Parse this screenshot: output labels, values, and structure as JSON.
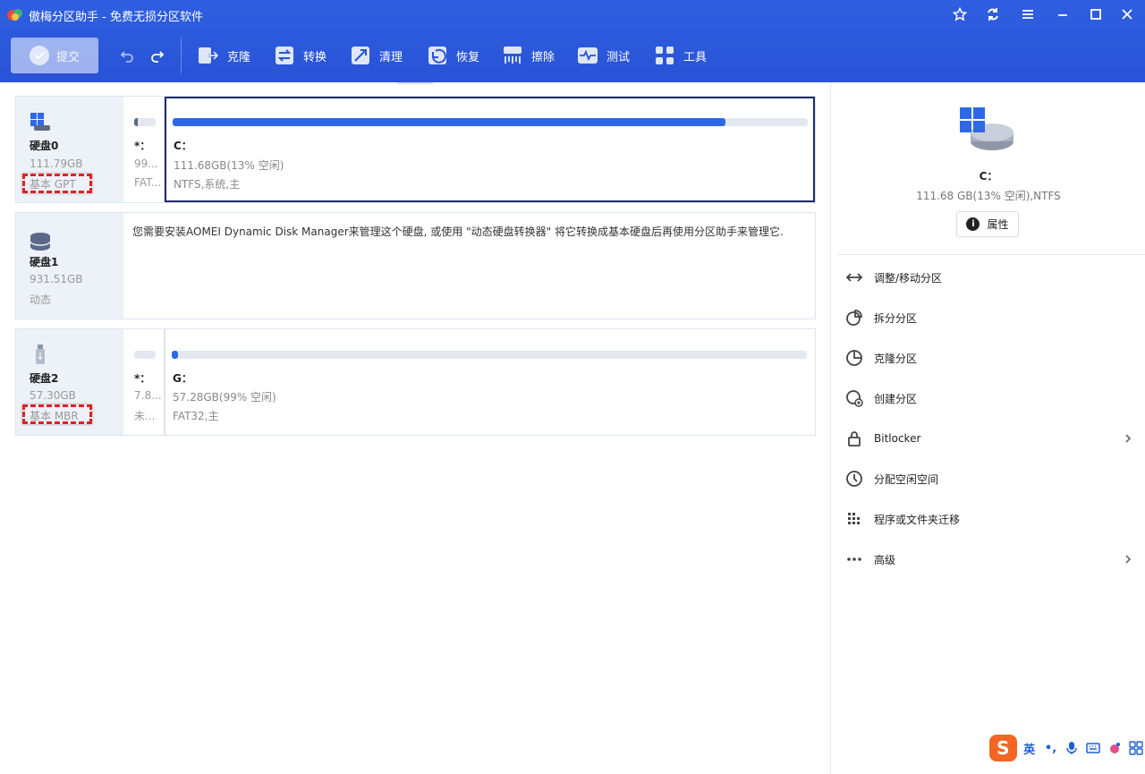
{
  "app": {
    "title": "傲梅分区助手 - 免费无损分区软件"
  },
  "window_controls": [
    "star-icon",
    "refresh-icon",
    "menu-icon",
    "minimize-icon",
    "maximize-icon",
    "close-icon"
  ],
  "toolbar": {
    "submit_label": "提交",
    "tools": [
      {
        "label": "克隆",
        "icon": "clone-icon"
      },
      {
        "label": "转换",
        "icon": "convert-icon"
      },
      {
        "label": "清理",
        "icon": "clean-icon"
      },
      {
        "label": "恢复",
        "icon": "recover-icon"
      },
      {
        "label": "擦除",
        "icon": "wipe-icon"
      },
      {
        "label": "测试",
        "icon": "test-icon"
      },
      {
        "label": "工具",
        "icon": "tools-icon"
      }
    ]
  },
  "disks": [
    {
      "name": "硬盘0",
      "size": "111.79GB",
      "type": "基本 GPT",
      "small_partition": {
        "label": "*：",
        "size": "99...",
        "fs": "FAT..."
      },
      "main_partition": {
        "label": "C：",
        "size": "111.68GB(13% 空闲)",
        "fs": "NTFS,系统,主",
        "used_fraction": 0.87
      }
    },
    {
      "name": "硬盘1",
      "size": "931.51GB",
      "type": "动态",
      "message": "您需要安装AOMEI Dynamic Disk Manager来管理这个硬盘, 或使用 \"动态硬盘转换器\" 将它转换成基本硬盘后再使用分区助手来管理它."
    },
    {
      "name": "硬盘2",
      "size": "57.30GB",
      "type": "基本 MBR",
      "small_partition": {
        "label": "*：",
        "size": "7.8...",
        "fs": "未..."
      },
      "main_partition": {
        "label": "G：",
        "size": "57.28GB(99% 空闲)",
        "fs": "FAT32,主",
        "used_fraction": 0.01
      }
    }
  ],
  "side_panel": {
    "partition_name": "C：",
    "partition_info": "111.68 GB(13% 空闲),NTFS",
    "properties_label": "属性",
    "menu": [
      {
        "label": "调整/移动分区",
        "icon": "resize-move-icon",
        "has_submenu": false
      },
      {
        "label": "拆分分区",
        "icon": "split-icon",
        "has_submenu": false
      },
      {
        "label": "克隆分区",
        "icon": "clone-partition-icon",
        "has_submenu": false
      },
      {
        "label": "创建分区",
        "icon": "create-partition-icon",
        "has_submenu": false
      },
      {
        "label": "Bitlocker",
        "icon": "lock-icon",
        "has_submenu": true
      },
      {
        "label": "分配空闲空间",
        "icon": "allocate-space-icon",
        "has_submenu": false
      },
      {
        "label": "程序或文件夹迁移",
        "icon": "migrate-icon",
        "has_submenu": false
      },
      {
        "label": "高级",
        "icon": "more-icon",
        "has_submenu": true
      }
    ]
  },
  "ime": {
    "logo": "S",
    "lang": "英",
    "punct": "•,"
  }
}
